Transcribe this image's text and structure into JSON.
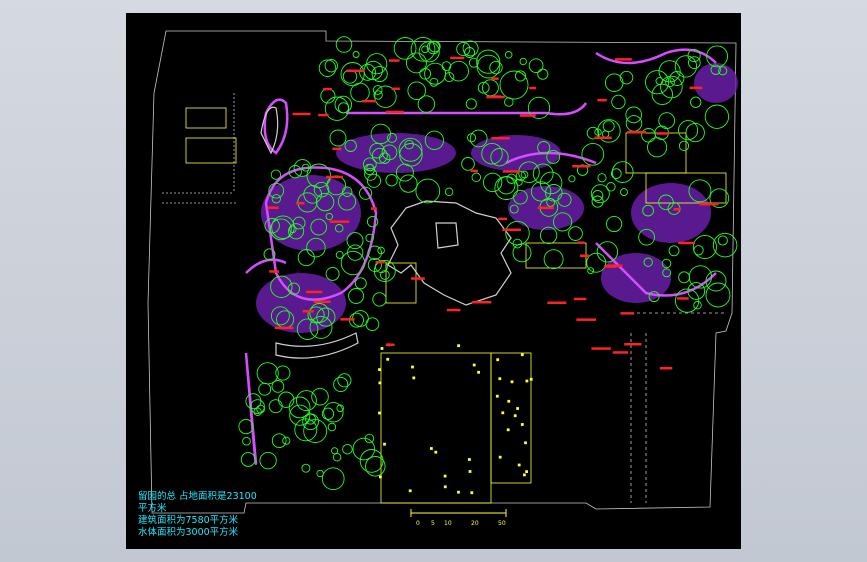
{
  "drawing": {
    "background_color": "#000000",
    "stats_lines": [
      "留园的总 占地面积是23100",
      "平方米",
      "建筑面积为7580平方米",
      "水体面积为3000平方米"
    ],
    "stats_color": "#22e6ff",
    "colors": {
      "boundary": "#c8c8c8",
      "vegetation_tree": "#22ff22",
      "vegetation_shrub": "#d64dff",
      "rockery": "#8a2be2",
      "building": "#ffff33",
      "water_outline": "#d0d0d0",
      "label": "#ff2222"
    },
    "scale_bar_labels": [
      "0",
      "5",
      "10",
      "20",
      "50"
    ]
  }
}
